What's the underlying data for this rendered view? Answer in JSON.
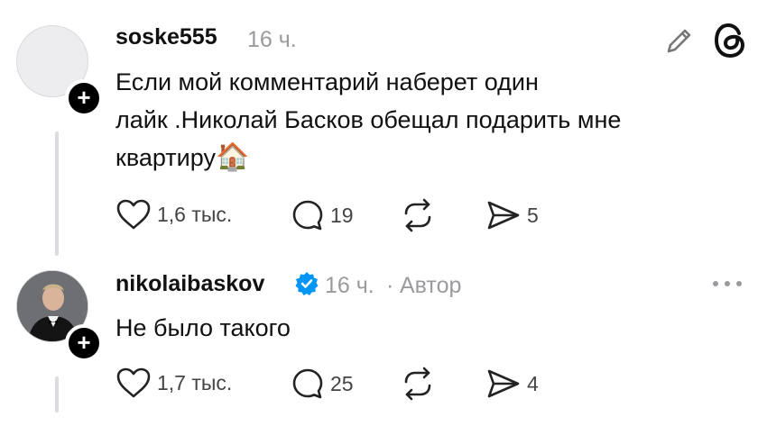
{
  "comments": [
    {
      "username": "soske555",
      "time": "16 ч.",
      "text_lines": [
        "Если мой комментарий наберет один",
        "лайк .Николай Басков обещал подарить  мне",
        "квартиру"
      ],
      "emoji": "🏠",
      "likes": "1,6 тыс.",
      "replies": "19",
      "shares": "5"
    },
    {
      "username": "nikolaibaskov",
      "time": "16 ч.",
      "separator": "·",
      "author_label": "Автор",
      "text": "Не было такого",
      "likes": "1,7 тыс.",
      "replies": "25",
      "shares": "4"
    }
  ],
  "colors": {
    "verified": "#0095f6",
    "meta": "#9a9a9f"
  },
  "icons": [
    "edit-icon",
    "threads-logo-icon",
    "more-icon",
    "heart-icon",
    "comment-icon",
    "repost-icon",
    "send-icon",
    "plus-icon",
    "verified-icon"
  ]
}
